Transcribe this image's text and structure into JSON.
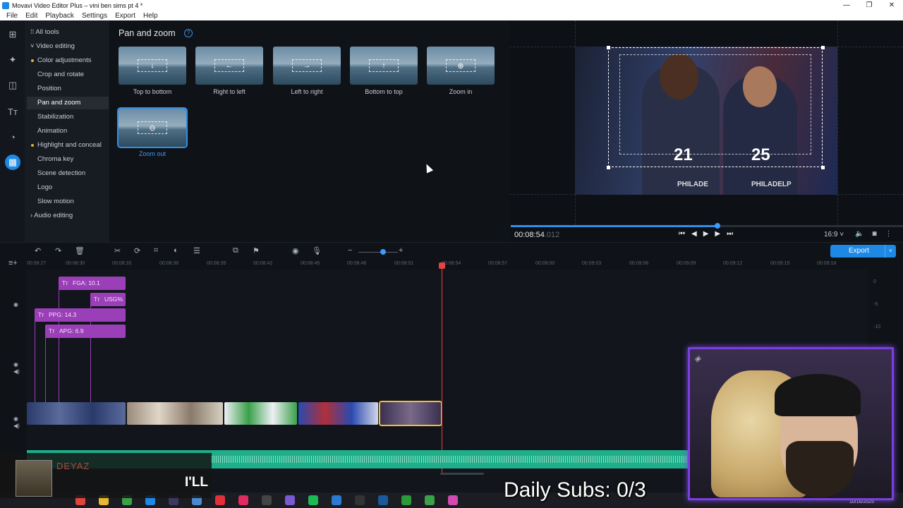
{
  "window": {
    "title": "Movavi Video Editor Plus – vini ben sims pt 4 *",
    "controls": [
      "—",
      "❐",
      "✕"
    ]
  },
  "menu": [
    "File",
    "Edit",
    "Playback",
    "Settings",
    "Export",
    "Help"
  ],
  "tools": {
    "items": [
      {
        "label": "All tools",
        "type": "header-grid"
      },
      {
        "label": "Video editing",
        "type": "expanded"
      },
      {
        "label": "Color adjustments",
        "type": "dot"
      },
      {
        "label": "Crop and rotate",
        "type": "plain"
      },
      {
        "label": "Position",
        "type": "plain"
      },
      {
        "label": "Pan and zoom",
        "type": "active"
      },
      {
        "label": "Stabilization",
        "type": "plain"
      },
      {
        "label": "Animation",
        "type": "plain"
      },
      {
        "label": "Highlight and conceal",
        "type": "dot"
      },
      {
        "label": "Chroma key",
        "type": "plain"
      },
      {
        "label": "Scene detection",
        "type": "plain"
      },
      {
        "label": "Logo",
        "type": "plain"
      },
      {
        "label": "Slow motion",
        "type": "plain"
      },
      {
        "label": "Audio editing",
        "type": "collapsed"
      }
    ]
  },
  "panel": {
    "title": "Pan and zoom",
    "help": "?",
    "presets": [
      {
        "label": "Top to bottom",
        "icon": "↓"
      },
      {
        "label": "Right to left",
        "icon": "←"
      },
      {
        "label": "Left to right",
        "icon": "→"
      },
      {
        "label": "Bottom to top",
        "icon": "↑"
      },
      {
        "label": "Zoom in",
        "icon": "⊕"
      },
      {
        "label": "Zoom out",
        "icon": "⊖"
      }
    ]
  },
  "preview": {
    "jersey_left": "21",
    "jersey_right": "25",
    "text_left": "PHILADE",
    "text_right": "PHILADELP",
    "timecode": "00:08:54",
    "timecode_ms": ".012",
    "progress": 0.52,
    "aspect": "16:9 ˅"
  },
  "export": {
    "label": "Export",
    "arrow": "˅"
  },
  "ruler": [
    "00:08:27",
    "00:08:30",
    "00:08:33",
    "00:08:36",
    "00:08:39",
    "00:08:42",
    "00:08:45",
    "00:08:48",
    "00:08:51",
    "00:08:54",
    "00:08:57",
    "00:09:00",
    "00:09:03",
    "00:09:06",
    "00:09:09",
    "00:09:12",
    "00:09:15",
    "00:09:18"
  ],
  "title_clips": [
    {
      "label": "FGA: 10.1"
    },
    {
      "label": "USG%"
    },
    {
      "label": "PPG: 14.3"
    },
    {
      "label": "APG: 6.9"
    }
  ],
  "levels": [
    "0",
    "-5",
    "-10"
  ],
  "now_playing": {
    "artist": "DEYAZ",
    "lyric": "I'LL"
  },
  "overlay": {
    "subs": "Daily Subs: 0/3"
  },
  "taskbar": {
    "date": "10/16/2025"
  },
  "colors": {
    "accent": "#1e88e5",
    "title_clip": "#9b3fb8",
    "audio": "#1fae8a",
    "playhead": "#e84141",
    "webcam_border": "#7b3fe0"
  }
}
